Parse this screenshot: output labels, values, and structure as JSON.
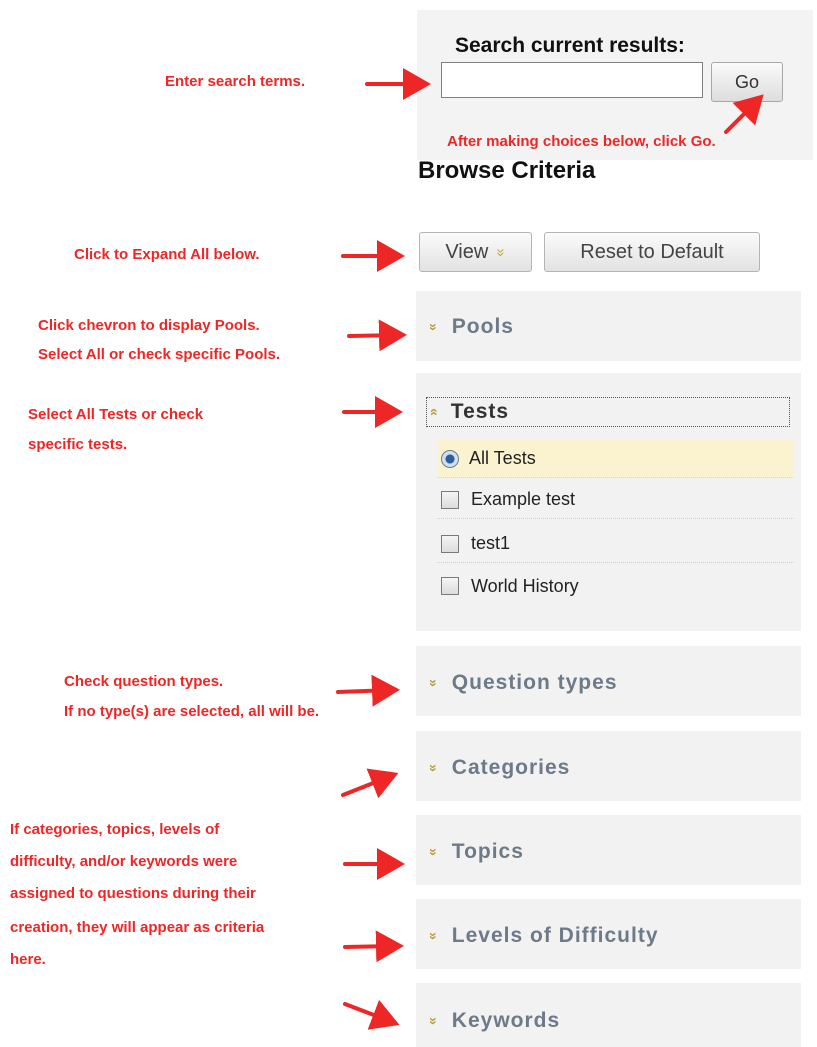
{
  "search": {
    "title": "Search current results:",
    "value": "",
    "go_label": "Go"
  },
  "browse_title": "Browse Criteria",
  "buttons": {
    "view_label": "View",
    "view_chevron": "»",
    "reset_label": "Reset to Default"
  },
  "icons": {
    "expand": "»",
    "collapse": "«"
  },
  "panels": {
    "pools": "Pools",
    "tests": "Tests",
    "question_types": "Question types",
    "categories": "Categories",
    "topics": "Topics",
    "levels": "Levels of Difficulty",
    "keywords": "Keywords"
  },
  "tests_options": [
    {
      "label": "All Tests",
      "type": "radio",
      "selected": true
    },
    {
      "label": "Example test",
      "type": "checkbox",
      "checked": false
    },
    {
      "label": "test1",
      "type": "checkbox",
      "checked": false
    },
    {
      "label": "World History",
      "type": "checkbox",
      "checked": false
    }
  ],
  "annotations": {
    "search": "Enter search terms.",
    "go": "After making choices below, click Go.",
    "expand": "Click to Expand All below.",
    "pools_1": "Click chevron to display Pools.",
    "pools_2": "Select All or check specific Pools.",
    "tests_1": "Select All Tests or check",
    "tests_2": "specific tests.",
    "qtypes_1": "Check question types.",
    "qtypes_2": "If no type(s) are selected, all will be.",
    "criteria_1": "If categories, topics, levels of",
    "criteria_2": "difficulty, and/or keywords were",
    "criteria_3": "assigned to questions during their",
    "criteria_4": "creation, they will appear as criteria",
    "criteria_5": "here."
  },
  "colors": {
    "annotation": "#ee2626",
    "panel_bg": "#f2f2f2",
    "panel_title": "#6d7a88",
    "chevron": "#b79d3d",
    "selected_row": "#fbf3cf"
  }
}
